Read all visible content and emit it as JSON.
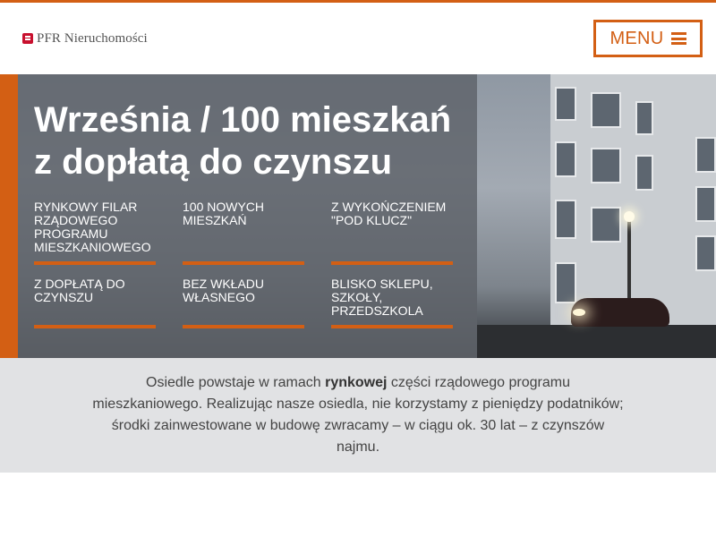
{
  "header": {
    "logo_text": "PFR Nieruchomości",
    "menu_label": "MENU"
  },
  "hero": {
    "title_line1": "Września / 100 mieszkań",
    "title_line2": "z dopłatą do czynszu",
    "features": [
      "RYNKOWY FILAR RZĄDOWEGO PROGRAMU MIESZKANIOWEGO",
      "100 NOWYCH MIESZKAŃ",
      "Z WYKOŃCZENIEM \"POD KLUCZ\"",
      "Z DOPŁATĄ DO CZYNSZU",
      "BEZ WKŁADU WŁASNEGO",
      "BLISKO SKLEPU, SZKOŁY, PRZEDSZKOLA"
    ]
  },
  "info": {
    "text_before": "Osiedle powstaje w ramach ",
    "text_bold": "rynkowej",
    "text_after": " części rządowego programu mieszkaniowego. Realizując nasze osiedla, nie korzystamy z pieniędzy podatników; środki zainwestowane w budowę zwracamy – w ciągu ok. 30 lat – z czynszów najmu."
  },
  "colors": {
    "accent": "#d35f14",
    "overlay": "#60646a",
    "info_bg": "#e1e2e4"
  }
}
